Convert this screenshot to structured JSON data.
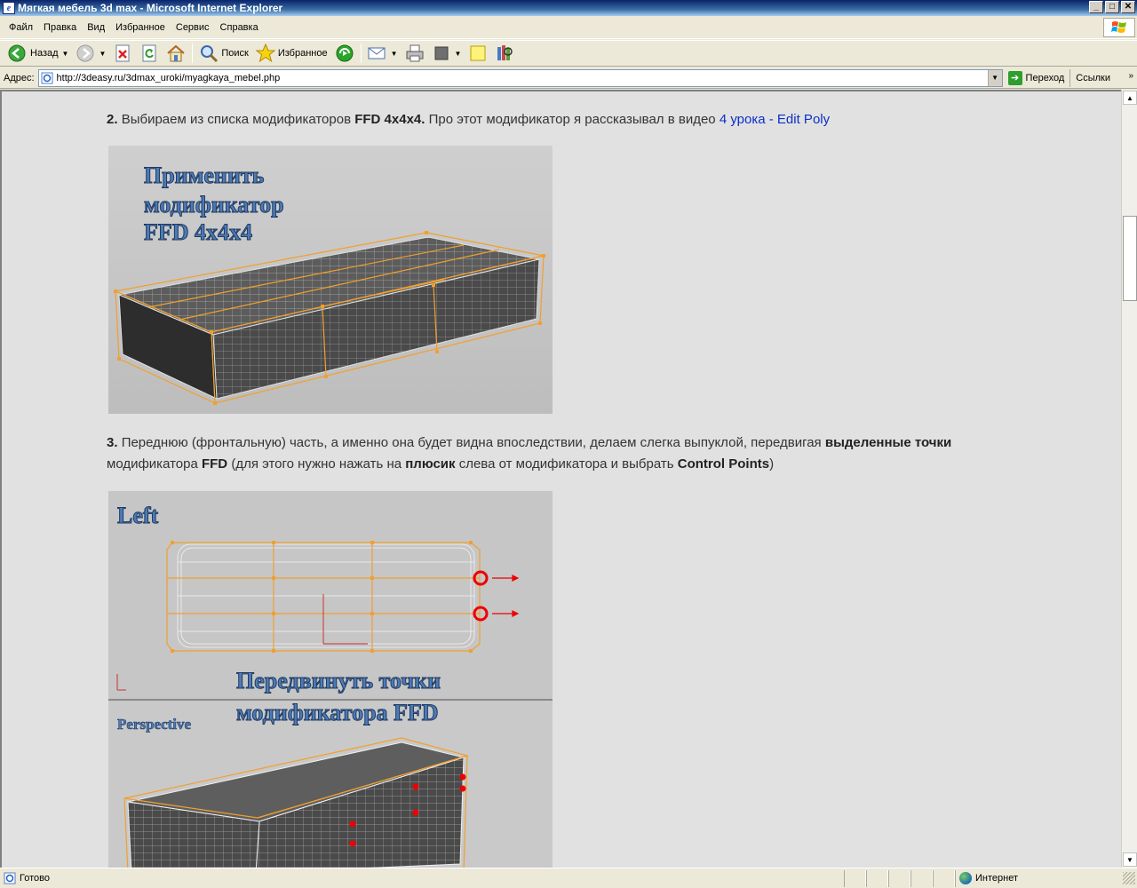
{
  "window": {
    "title": "Мягкая мебель 3d max - Microsoft Internet Explorer",
    "buttons": {
      "minimize": "_",
      "maximize": "□",
      "close": "✕"
    }
  },
  "menu": {
    "items": [
      {
        "label": "Файл"
      },
      {
        "label": "Правка"
      },
      {
        "label": "Вид"
      },
      {
        "label": "Избранное"
      },
      {
        "label": "Сервис"
      },
      {
        "label": "Справка"
      }
    ]
  },
  "toolbar": {
    "back_label": "Назад",
    "search_label": "Поиск",
    "favorites_label": "Избранное"
  },
  "address": {
    "label": "Адрес:",
    "url": "http://3deasy.ru/3dmax_uroki/myagkaya_mebel.php",
    "go_label": "Переход",
    "links_label": "Ссылки"
  },
  "content": {
    "step2": {
      "num": "2.",
      "text1": "Выбираем из списка модификаторов",
      "bold1": "FFD 4x4x4.",
      "text2": "Про этот модификатор я рассказывал в видео",
      "link": "4 урока - Edit Poly"
    },
    "image1": {
      "line1": "Применить",
      "line2": "модификатор",
      "line3": "FFD 4x4x4"
    },
    "step3": {
      "num": "3.",
      "text1": "Переднюю (фронтальную) часть, а именно она будет видна впоследствии, делаем слегка выпуклой, передвигая",
      "bold1": "выделенные точки",
      "text2": "модификатора",
      "bold2": "FFD",
      "text3": "(для этого нужно нажать на",
      "bold3": "плюсик",
      "text4": "слева от модификатора и выбрать",
      "bold4": "Control Points",
      "text5": ")"
    },
    "image2": {
      "viewport_top": "Left",
      "viewport_bottom": "Perspective",
      "caption1": "Передвинуть точки",
      "caption2": "модификатора FFD"
    }
  },
  "status": {
    "text": "Готово",
    "zone": "Интернет"
  },
  "colors": {
    "link": "#0b2fc7",
    "page_bg": "#e1e1e1",
    "title_bar": "#0a246a",
    "ffd_lattice": "#f0a030",
    "selection": "#e00000"
  }
}
